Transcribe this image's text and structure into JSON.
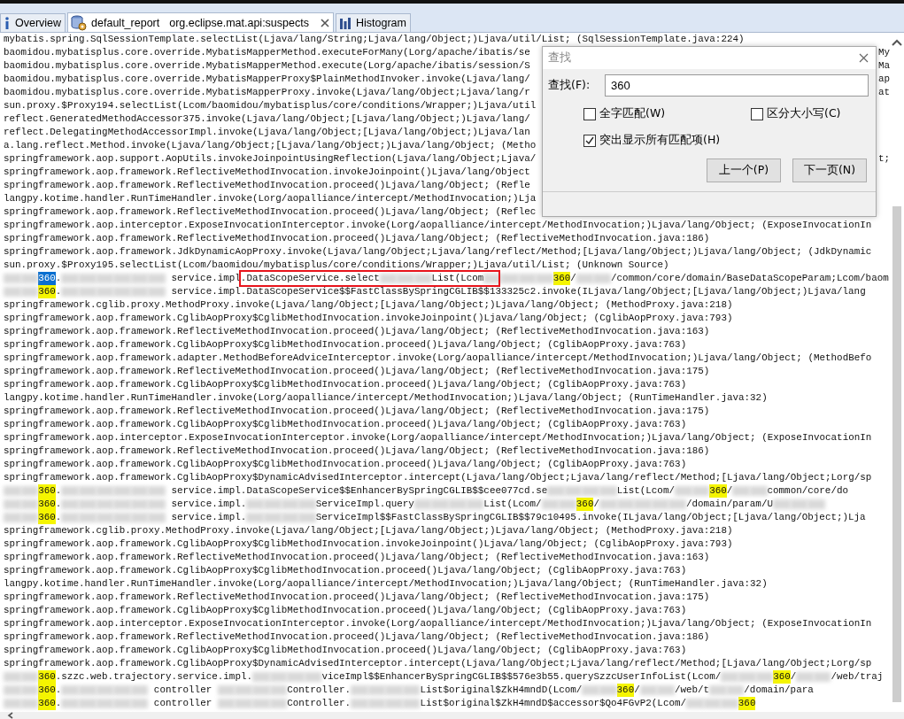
{
  "tabs": [
    {
      "kind": "info",
      "label": "Overview",
      "selected": false,
      "closable": false
    },
    {
      "kind": "database",
      "label": "default_report",
      "detail": "org.eclipse.mat.api:suspects",
      "selected": true,
      "closable": true
    },
    {
      "kind": "histogram",
      "label": "Histogram",
      "selected": false,
      "closable": false
    }
  ],
  "code_lines": [
    {
      "text": "mybatis.spring.SqlSessionTemplate.selectList(Ljava/lang/String;Ljava/lang/Object;)Ljava/util/List; (SqlSessionTemplate.java:224)"
    },
    {
      "text": "baomidou.mybatisplus.core.override.MybatisMapperMethod.executeForMany(Lorg/apache/ibatis/se",
      "tail": "My"
    },
    {
      "text": "baomidou.mybatisplus.core.override.MybatisMapperMethod.execute(Lorg/apache/ibatis/session/S",
      "tail": "Ma"
    },
    {
      "text": "baomidou.mybatisplus.core.override.MybatisMapperProxy$PlainMethodInvoker.invoke(Ljava/lang/",
      "tail": "ap"
    },
    {
      "text": "baomidou.mybatisplus.core.override.MybatisMapperProxy.invoke(Ljava/lang/Object;Ljava/lang/r",
      "tail": "at"
    },
    {
      "text": "sun.proxy.$Proxy194.selectList(Lcom/baomidou/mybatisplus/core/conditions/Wrapper;)Ljava/util"
    },
    {
      "text": "reflect.GeneratedMethodAccessor375.invoke(Ljava/lang/Object;[Ljava/lang/Object;)Ljava/lang/"
    },
    {
      "text": "reflect.DelegatingMethodAccessorImpl.invoke(Ljava/lang/Object;[Ljava/lang/Object;)Ljava/lan"
    },
    {
      "text": "a.lang.reflect.Method.invoke(Ljava/lang/Object;[Ljava/lang/Object;)Ljava/lang/Object; (Metho"
    },
    {
      "text": "springframework.aop.support.AopUtils.invokeJoinpointUsingReflection(Ljava/lang/Object;Ljava/",
      "tail": "t;"
    },
    {
      "text": "springframework.aop.framework.ReflectiveMethodInvocation.invokeJoinpoint()Ljava/lang/Object"
    },
    {
      "text": "springframework.aop.framework.ReflectiveMethodInvocation.proceed()Ljava/lang/Object; (Refle"
    },
    {
      "text": "langpy.kotime.handler.RunTimeHandler.invoke(Lorg/aopalliance/intercept/MethodInvocation;)Lja"
    },
    {
      "text": "springframework.aop.framework.ReflectiveMethodInvocation.proceed()Ljava/lang/Object; (Reflec"
    },
    {
      "text": "springframework.aop.interceptor.ExposeInvocationInterceptor.invoke(Lorg/aopalliance/intercept/MethodInvocation;)Ljava/lang/Object; (ExposeInvocationIn"
    },
    {
      "text": "springframework.aop.framework.ReflectiveMethodInvocation.proceed()Ljava/lang/Object; (ReflectiveMethodInvocation.java:186)"
    },
    {
      "text": "springframework.aop.framework.JdkDynamicAopProxy.invoke(Ljava/lang/Object;Ljava/lang/reflect/Method;[Ljava/lang/Object;)Ljava/lang/Object; (JdkDynamic"
    },
    {
      "text": "sun.proxy.$Proxy195.selectList(Lcom/baomidou/mybatisplus/core/conditions/Wrapper;)Ljava/util/List; (Unknown Source)"
    },
    {
      "parts": [
        {
          "kind": "blur"
        },
        {
          "kind": "blur"
        },
        {
          "kind": "match",
          "text": "360",
          "selected": true
        },
        {
          "kind": "text",
          "text": "."
        },
        {
          "kind": "blur"
        },
        {
          "kind": "blur"
        },
        {
          "kind": "blur"
        },
        {
          "kind": "blur"
        },
        {
          "kind": "blur"
        },
        {
          "kind": "blur"
        },
        {
          "kind": "text",
          "text": " service.impl.DataScopeService.select"
        },
        {
          "kind": "blur"
        },
        {
          "kind": "blur"
        },
        {
          "kind": "blur"
        },
        {
          "kind": "text",
          "text": "List(Lcom"
        },
        {
          "kind": "blur"
        },
        {
          "kind": "blur"
        },
        {
          "kind": "blur"
        },
        {
          "kind": "blur"
        },
        {
          "kind": "match",
          "text": "360",
          "selected": false
        },
        {
          "kind": "text",
          "text": "/"
        },
        {
          "kind": "blur"
        },
        {
          "kind": "blur"
        },
        {
          "kind": "text",
          "text": "/common/core/domain/BaseDataScopeParam;Lcom/baom"
        }
      ]
    },
    {
      "parts": [
        {
          "kind": "blur"
        },
        {
          "kind": "blur"
        },
        {
          "kind": "match",
          "text": "360",
          "selected": false
        },
        {
          "kind": "text",
          "text": "."
        },
        {
          "kind": "blur"
        },
        {
          "kind": "blur"
        },
        {
          "kind": "blur"
        },
        {
          "kind": "blur"
        },
        {
          "kind": "blur"
        },
        {
          "kind": "blur"
        },
        {
          "kind": "text",
          "text": " service.impl.DataScopeService$$FastClassBySpringCGLIB$$133325c2.invoke(ILjava/lang/Object;[Ljava/lang/Object;)Ljava/lang"
        }
      ]
    },
    {
      "text": "springframework.cglib.proxy.MethodProxy.invoke(Ljava/lang/Object;[Ljava/lang/Object;)Ljava/lang/Object; (MethodProxy.java:218)"
    },
    {
      "text": "springframework.aop.framework.CglibAopProxy$CglibMethodInvocation.invokeJoinpoint()Ljava/lang/Object; (CglibAopProxy.java:793)"
    },
    {
      "text": "springframework.aop.framework.ReflectiveMethodInvocation.proceed()Ljava/lang/Object; (ReflectiveMethodInvocation.java:163)"
    },
    {
      "text": "springframework.aop.framework.CglibAopProxy$CglibMethodInvocation.proceed()Ljava/lang/Object; (CglibAopProxy.java:763)"
    },
    {
      "text": "springframework.aop.framework.adapter.MethodBeforeAdviceInterceptor.invoke(Lorg/aopalliance/intercept/MethodInvocation;)Ljava/lang/Object; (MethodBefo"
    },
    {
      "text": "springframework.aop.framework.ReflectiveMethodInvocation.proceed()Ljava/lang/Object; (ReflectiveMethodInvocation.java:175)"
    },
    {
      "text": "springframework.aop.framework.CglibAopProxy$CglibMethodInvocation.proceed()Ljava/lang/Object; (CglibAopProxy.java:763)"
    },
    {
      "text": "langpy.kotime.handler.RunTimeHandler.invoke(Lorg/aopalliance/intercept/MethodInvocation;)Ljava/lang/Object; (RunTimeHandler.java:32)"
    },
    {
      "text": "springframework.aop.framework.ReflectiveMethodInvocation.proceed()Ljava/lang/Object; (ReflectiveMethodInvocation.java:175)"
    },
    {
      "text": "springframework.aop.framework.CglibAopProxy$CglibMethodInvocation.proceed()Ljava/lang/Object; (CglibAopProxy.java:763)"
    },
    {
      "text": "springframework.aop.interceptor.ExposeInvocationInterceptor.invoke(Lorg/aopalliance/intercept/MethodInvocation;)Ljava/lang/Object; (ExposeInvocationIn"
    },
    {
      "text": "springframework.aop.framework.ReflectiveMethodInvocation.proceed()Ljava/lang/Object; (ReflectiveMethodInvocation.java:186)"
    },
    {
      "text": "springframework.aop.framework.CglibAopProxy$CglibMethodInvocation.proceed()Ljava/lang/Object; (CglibAopProxy.java:763)"
    },
    {
      "text": "springframework.aop.framework.CglibAopProxy$DynamicAdvisedInterceptor.intercept(Ljava/lang/Object;Ljava/lang/reflect/Method;[Ljava/lang/Object;Lorg/sp"
    },
    {
      "parts": [
        {
          "kind": "blur"
        },
        {
          "kind": "blur"
        },
        {
          "kind": "match",
          "text": "360",
          "selected": false
        },
        {
          "kind": "text",
          "text": "."
        },
        {
          "kind": "blur"
        },
        {
          "kind": "blur"
        },
        {
          "kind": "blur"
        },
        {
          "kind": "blur"
        },
        {
          "kind": "blur"
        },
        {
          "kind": "blur"
        },
        {
          "kind": "text",
          "text": " service.impl.DataScopeService$$EnhancerBySpringCGLIB$$cee077cd.se"
        },
        {
          "kind": "blur"
        },
        {
          "kind": "blur"
        },
        {
          "kind": "blur"
        },
        {
          "kind": "blur"
        },
        {
          "kind": "text",
          "text": "List(Lcom/"
        },
        {
          "kind": "blur"
        },
        {
          "kind": "blur"
        },
        {
          "kind": "match",
          "text": "360",
          "selected": false
        },
        {
          "kind": "text",
          "text": "/"
        },
        {
          "kind": "blur"
        },
        {
          "kind": "blur"
        },
        {
          "kind": "text",
          "text": "common/core/do"
        }
      ]
    },
    {
      "parts": [
        {
          "kind": "blur"
        },
        {
          "kind": "blur"
        },
        {
          "kind": "match",
          "text": "360",
          "selected": false
        },
        {
          "kind": "text",
          "text": "."
        },
        {
          "kind": "blur"
        },
        {
          "kind": "blur"
        },
        {
          "kind": "blur"
        },
        {
          "kind": "blur"
        },
        {
          "kind": "blur"
        },
        {
          "kind": "blur"
        },
        {
          "kind": "text",
          "text": " service.impl."
        },
        {
          "kind": "blur"
        },
        {
          "kind": "blur"
        },
        {
          "kind": "blur"
        },
        {
          "kind": "blur"
        },
        {
          "kind": "text",
          "text": "ServiceImpl.query"
        },
        {
          "kind": "blur"
        },
        {
          "kind": "blur"
        },
        {
          "kind": "blur"
        },
        {
          "kind": "blur"
        },
        {
          "kind": "text",
          "text": "List(Lcom/"
        },
        {
          "kind": "blur"
        },
        {
          "kind": "blur"
        },
        {
          "kind": "match",
          "text": "360",
          "selected": false
        },
        {
          "kind": "text",
          "text": "/"
        },
        {
          "kind": "blur"
        },
        {
          "kind": "blur"
        },
        {
          "kind": "blur"
        },
        {
          "kind": "blur"
        },
        {
          "kind": "blur"
        },
        {
          "kind": "text",
          "text": "/domain/param/U"
        },
        {
          "kind": "blur"
        },
        {
          "kind": "blur"
        },
        {
          "kind": "blur"
        }
      ]
    },
    {
      "parts": [
        {
          "kind": "blur"
        },
        {
          "kind": "blur"
        },
        {
          "kind": "match",
          "text": "360",
          "selected": false
        },
        {
          "kind": "text",
          "text": "."
        },
        {
          "kind": "blur"
        },
        {
          "kind": "blur"
        },
        {
          "kind": "blur"
        },
        {
          "kind": "blur"
        },
        {
          "kind": "blur"
        },
        {
          "kind": "blur"
        },
        {
          "kind": "text",
          "text": " service.impl."
        },
        {
          "kind": "blur"
        },
        {
          "kind": "blur"
        },
        {
          "kind": "blur"
        },
        {
          "kind": "blur"
        },
        {
          "kind": "text",
          "text": "ServiceImpl$$FastClassBySpringCGLIB$$79c10495.invoke(ILjava/lang/Object;[Ljava/lang/Object;)Lja"
        }
      ]
    },
    {
      "text": "springframework.cglib.proxy.MethodProxy.invoke(Ljava/lang/Object;[Ljava/lang/Object;)Ljava/lang/Object; (MethodProxy.java:218)"
    },
    {
      "text": "springframework.aop.framework.CglibAopProxy$CglibMethodInvocation.invokeJoinpoint()Ljava/lang/Object; (CglibAopProxy.java:793)"
    },
    {
      "text": "springframework.aop.framework.ReflectiveMethodInvocation.proceed()Ljava/lang/Object; (ReflectiveMethodInvocation.java:163)"
    },
    {
      "text": "springframework.aop.framework.CglibAopProxy$CglibMethodInvocation.proceed()Ljava/lang/Object; (CglibAopProxy.java:763)"
    },
    {
      "text": "langpy.kotime.handler.RunTimeHandler.invoke(Lorg/aopalliance/intercept/MethodInvocation;)Ljava/lang/Object; (RunTimeHandler.java:32)"
    },
    {
      "text": "springframework.aop.framework.ReflectiveMethodInvocation.proceed()Ljava/lang/Object; (ReflectiveMethodInvocation.java:175)"
    },
    {
      "text": "springframework.aop.framework.CglibAopProxy$CglibMethodInvocation.proceed()Ljava/lang/Object; (CglibAopProxy.java:763)"
    },
    {
      "text": "springframework.aop.interceptor.ExposeInvocationInterceptor.invoke(Lorg/aopalliance/intercept/MethodInvocation;)Ljava/lang/Object; (ExposeInvocationIn"
    },
    {
      "text": "springframework.aop.framework.ReflectiveMethodInvocation.proceed()Ljava/lang/Object; (ReflectiveMethodInvocation.java:186)"
    },
    {
      "text": "springframework.aop.framework.CglibAopProxy$CglibMethodInvocation.proceed()Ljava/lang/Object; (CglibAopProxy.java:763)"
    },
    {
      "text": "springframework.aop.framework.CglibAopProxy$DynamicAdvisedInterceptor.intercept(Ljava/lang/Object;Ljava/lang/reflect/Method;[Ljava/lang/Object;Lorg/sp"
    },
    {
      "parts": [
        {
          "kind": "blur"
        },
        {
          "kind": "blur"
        },
        {
          "kind": "match",
          "text": "360",
          "selected": false
        },
        {
          "kind": "text",
          "text": ".szzc.web.trajectory.service.impl."
        },
        {
          "kind": "blur"
        },
        {
          "kind": "blur"
        },
        {
          "kind": "blur"
        },
        {
          "kind": "blur"
        },
        {
          "kind": "text",
          "text": "viceImpl$$EnhancerBySpringCGLIB$$576e3b55.querySzzcUserInfoList(Lcom/"
        },
        {
          "kind": "blur"
        },
        {
          "kind": "blur"
        },
        {
          "kind": "blur"
        },
        {
          "kind": "match",
          "text": "360",
          "selected": false
        },
        {
          "kind": "text",
          "text": "/"
        },
        {
          "kind": "blur"
        },
        {
          "kind": "blur"
        },
        {
          "kind": "text",
          "text": "/web/traj"
        }
      ]
    },
    {
      "parts": [
        {
          "kind": "blur"
        },
        {
          "kind": "blur"
        },
        {
          "kind": "match",
          "text": "360",
          "selected": false
        },
        {
          "kind": "text",
          "text": "."
        },
        {
          "kind": "blur"
        },
        {
          "kind": "blur"
        },
        {
          "kind": "blur"
        },
        {
          "kind": "blur"
        },
        {
          "kind": "blur"
        },
        {
          "kind": "text",
          "text": " controller "
        },
        {
          "kind": "blur"
        },
        {
          "kind": "blur"
        },
        {
          "kind": "blur"
        },
        {
          "kind": "blur"
        },
        {
          "kind": "text",
          "text": "Controller."
        },
        {
          "kind": "blur"
        },
        {
          "kind": "blur"
        },
        {
          "kind": "blur"
        },
        {
          "kind": "blur"
        },
        {
          "kind": "text",
          "text": "List$original$ZkH4mndD(Lcom/"
        },
        {
          "kind": "blur"
        },
        {
          "kind": "blur"
        },
        {
          "kind": "match",
          "text": "360",
          "selected": false
        },
        {
          "kind": "text",
          "text": "/"
        },
        {
          "kind": "blur"
        },
        {
          "kind": "blur"
        },
        {
          "kind": "text",
          "text": "/web/t"
        },
        {
          "kind": "blur"
        },
        {
          "kind": "blur"
        },
        {
          "kind": "text",
          "text": "/domain/para"
        }
      ]
    },
    {
      "parts": [
        {
          "kind": "blur"
        },
        {
          "kind": "blur"
        },
        {
          "kind": "match",
          "text": "360",
          "selected": false
        },
        {
          "kind": "text",
          "text": "."
        },
        {
          "kind": "blur"
        },
        {
          "kind": "blur"
        },
        {
          "kind": "blur"
        },
        {
          "kind": "blur"
        },
        {
          "kind": "blur"
        },
        {
          "kind": "text",
          "text": " controller "
        },
        {
          "kind": "blur"
        },
        {
          "kind": "blur"
        },
        {
          "kind": "blur"
        },
        {
          "kind": "blur"
        },
        {
          "kind": "text",
          "text": "Controller."
        },
        {
          "kind": "blur"
        },
        {
          "kind": "blur"
        },
        {
          "kind": "blur"
        },
        {
          "kind": "blur"
        },
        {
          "kind": "text",
          "text": "List$original$ZkH4mndD$accessor$Qo4FGvP2(Lcom/"
        },
        {
          "kind": "blur"
        },
        {
          "kind": "blur"
        },
        {
          "kind": "blur"
        },
        {
          "kind": "match",
          "text": "360",
          "selected": false
        }
      ]
    }
  ],
  "find_dialog": {
    "title": "查找",
    "find_label": "查找(F):",
    "value": "360",
    "options": [
      {
        "label": "全字匹配(W)",
        "checked": false
      },
      {
        "label": "区分大小写(C)",
        "checked": false
      },
      {
        "label": "突出显示所有匹配项(H)",
        "checked": true
      }
    ],
    "buttons": [
      "上一个(P)",
      "下一页(N)"
    ]
  }
}
